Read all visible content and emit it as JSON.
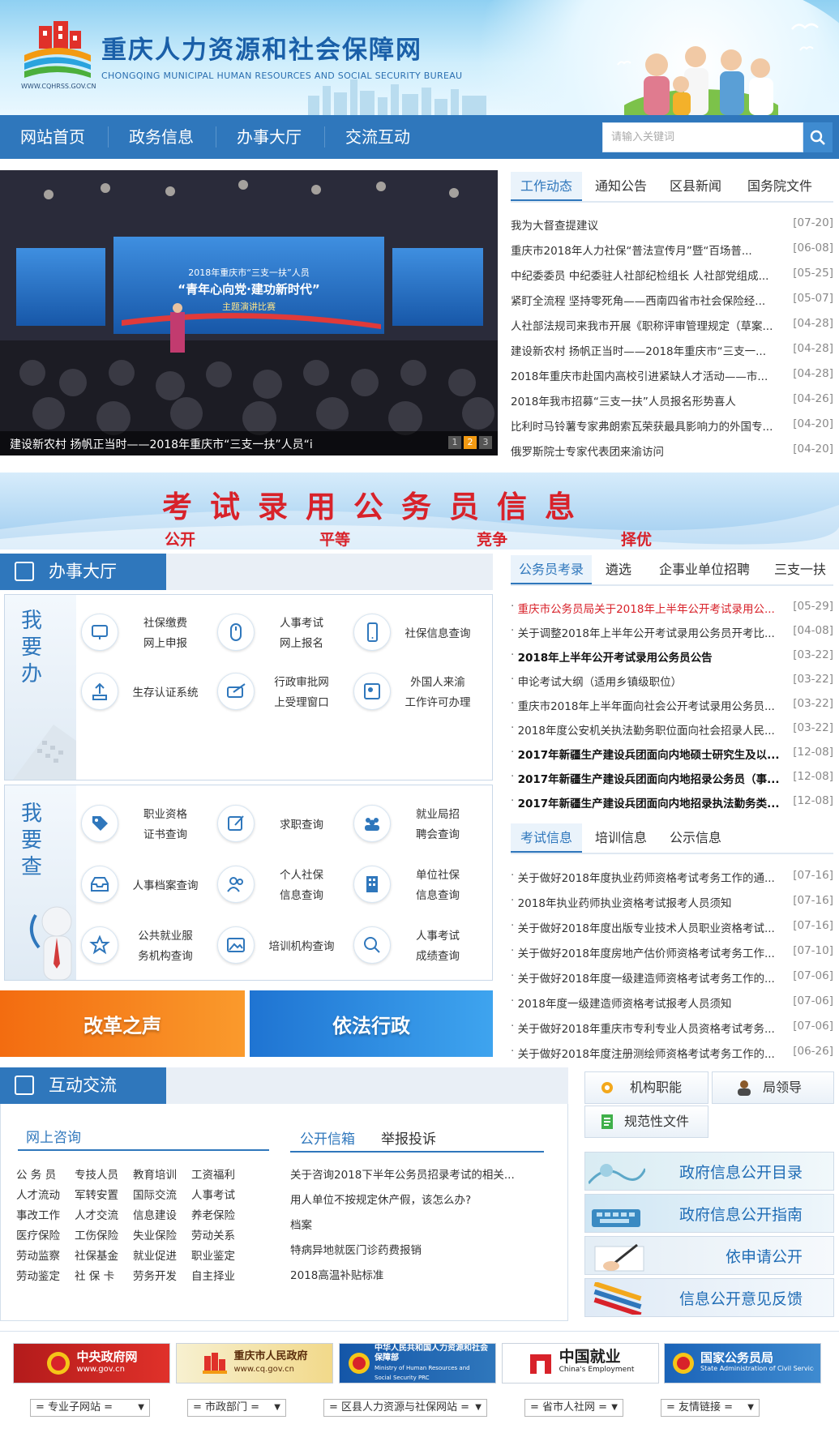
{
  "header": {
    "title": "重庆人力资源和社会保障网",
    "subtitle_en": "CHONGQING MUNICIPAL HUMAN RESOURCES AND SOCIAL SECURITY BUREAU",
    "url": "WWW.CQHRSS.GOV.CN"
  },
  "nav": {
    "items": [
      "网站首页",
      "政务信息",
      "办事大厅",
      "交流互动"
    ],
    "search_placeholder": "请输入关键词"
  },
  "slide": {
    "caption": "建设新农村 扬帆正当时——2018年重庆市“三支一扶”人员“i",
    "screen_title": "2018年重庆市“三支一扶”人员",
    "screen_main": "“青年心向党·建功新时代”",
    "screen_sub": "主题演讲比赛",
    "pages": [
      "1",
      "2",
      "3"
    ],
    "active_page": 2
  },
  "news": {
    "tabs": [
      "工作动态",
      "通知公告",
      "区县新闻",
      "国务院文件"
    ],
    "items": [
      {
        "title": "我为大督查提建议",
        "date": "[07-20]"
      },
      {
        "title": "重庆市2018年人力社保“普法宣传月”暨“百场普...",
        "date": "[06-08]"
      },
      {
        "title": "中纪委委员 中纪委驻人社部纪检组长 人社部党组成...",
        "date": "[05-25]"
      },
      {
        "title": "紧盯全流程 坚持零死角——西南四省市社会保险经...",
        "date": "[05-07]"
      },
      {
        "title": "人社部法规司来我市开展《职称评审管理规定（草案...",
        "date": "[04-28]"
      },
      {
        "title": "建设新农村 扬帆正当时——2018年重庆市“三支一...",
        "date": "[04-28]"
      },
      {
        "title": "2018年重庆市赴国内高校引进紧缺人才活动——市...",
        "date": "[04-28]"
      },
      {
        "title": "2018年我市招募“三支一扶”人员报名形势喜人",
        "date": "[04-26]"
      },
      {
        "title": "比利时马铃薯专家弗朗索瓦荣获最具影响力的外国专...",
        "date": "[04-20]"
      },
      {
        "title": "俄罗斯院士专家代表团来渝访问",
        "date": "[04-20]"
      }
    ]
  },
  "exam_banner": {
    "title": "考试录用公务员信息",
    "subs": [
      "公开",
      "平等",
      "竞争",
      "择优"
    ]
  },
  "service": {
    "title": "办事大厅",
    "want_do": "我要办",
    "want_check": "我要查",
    "do_items": [
      [
        "社保缴费",
        "网上申报"
      ],
      [
        "人事考试",
        "网上报名"
      ],
      [
        "社保信息查询"
      ],
      [
        "生存认证系统"
      ],
      [
        "行政审批网",
        "上受理窗口"
      ],
      [
        "外国人来渝",
        "工作许可办理"
      ]
    ],
    "check_items": [
      [
        "职业资格",
        "证书查询"
      ],
      [
        "求职查询"
      ],
      [
        "就业局招",
        "聘会查询"
      ],
      [
        "人事档案查询"
      ],
      [
        "个人社保",
        "信息查询"
      ],
      [
        "单位社保",
        "信息查询"
      ],
      [
        "公共就业服",
        "务机构查询"
      ],
      [
        "培训机构查询"
      ],
      [
        "人事考试",
        "成绩查询"
      ]
    ]
  },
  "civil": {
    "tabs": [
      "公务员考录",
      "遴选",
      "企事业单位招聘",
      "三支一扶"
    ],
    "items": [
      {
        "title": "重庆市公务员局关于2018年上半年公开考试录用公...",
        "date": "[05-29]",
        "hot": true
      },
      {
        "title": "关于调整2018年上半年公开考试录用公务员开考比...",
        "date": "[04-08]"
      },
      {
        "title": "2018年上半年公开考试录用公务员公告",
        "date": "[03-22]",
        "bold": true
      },
      {
        "title": "申论考试大纲（适用乡镇级职位）",
        "date": "[03-22]"
      },
      {
        "title": "重庆市2018年上半年面向社会公开考试录用公务员...",
        "date": "[03-22]"
      },
      {
        "title": "2018年度公安机关执法勤务职位面向社会招录人民...",
        "date": "[03-22]"
      },
      {
        "title": "2017年新疆生产建设兵团面向内地硕士研究生及以...",
        "date": "[12-08]",
        "bold": true
      },
      {
        "title": "2017年新疆生产建设兵团面向内地招录公务员（事...",
        "date": "[12-08]",
        "bold": true
      },
      {
        "title": "2017年新疆生产建设兵团面向内地招录执法勤务类...",
        "date": "[12-08]",
        "bold": true
      }
    ]
  },
  "exam_info": {
    "tabs": [
      "考试信息",
      "培训信息",
      "公示信息"
    ],
    "items": [
      {
        "title": "关于做好2018年度执业药师资格考试考务工作的通...",
        "date": "[07-16]"
      },
      {
        "title": "2018年执业药师执业资格考试报考人员须知",
        "date": "[07-16]"
      },
      {
        "title": "关于做好2018年度出版专业技术人员职业资格考试...",
        "date": "[07-16]"
      },
      {
        "title": "关于做好2018年度房地产估价师资格考试考务工作...",
        "date": "[07-10]"
      },
      {
        "title": "关于做好2018年度一级建造师资格考试考务工作的...",
        "date": "[07-06]"
      },
      {
        "title": "2018年度一级建造师资格考试报考人员须知",
        "date": "[07-06]"
      },
      {
        "title": "关于做好2018年重庆市专利专业人员资格考试考务...",
        "date": "[07-06]"
      },
      {
        "title": "关于做好2018年度注册测绘师资格考试考务工作的...",
        "date": "[06-26]"
      }
    ]
  },
  "promos": [
    "改革之声",
    "依法行政"
  ],
  "interact": {
    "title": "互动交流",
    "consult_tab": "网上咨询",
    "mail_tab": "公开信箱",
    "report_tab": "举报投诉",
    "keywords": [
      [
        "公 务 员",
        "专技人员",
        "教育培训",
        "工资福利"
      ],
      [
        "人才流动",
        "军转安置",
        "国际交流",
        "人事考试"
      ],
      [
        "事改工作",
        "人才交流",
        "信息建设",
        "养老保险"
      ],
      [
        "医疗保险",
        "工伤保险",
        "失业保险",
        "劳动关系"
      ],
      [
        "劳动监察",
        "社保基金",
        "就业促进",
        "职业鉴定"
      ],
      [
        "劳动鉴定",
        "社 保 卡",
        "劳务开发",
        "自主择业"
      ]
    ],
    "mails": [
      "关于咨询2018下半年公务员招录考试的相关...",
      "用人单位不按规定休产假，该怎么办?",
      "档案",
      "特病异地就医门诊药费报销",
      "2018高温补贴标准"
    ]
  },
  "quick": {
    "buttons": [
      "机构职能",
      "局领导",
      "规范性文件"
    ],
    "gov": [
      "政府信息公开目录",
      "政府信息公开指南",
      "依申请公开",
      "信息公开意见反馈"
    ]
  },
  "footer": {
    "logos": [
      {
        "t": "中央政府网",
        "s": "www.gov.cn"
      },
      {
        "t": "重庆市人民政府",
        "s": "www.cq.gov.cn"
      },
      {
        "t": "中华人民共和国人力资源和社会保障部",
        "s": "Ministry of Human Resources and Social Security PRC"
      },
      {
        "t": "中国就业",
        "s": "China's Employment"
      },
      {
        "t": "国家公务员局",
        "s": "State Administration of Civil Service"
      }
    ],
    "selects": [
      "= 专业子网站 =",
      "= 市政部门 =",
      "= 区县人力资源与社保网站 =",
      "= 省市人社网 =",
      "= 友情链接 ="
    ]
  }
}
